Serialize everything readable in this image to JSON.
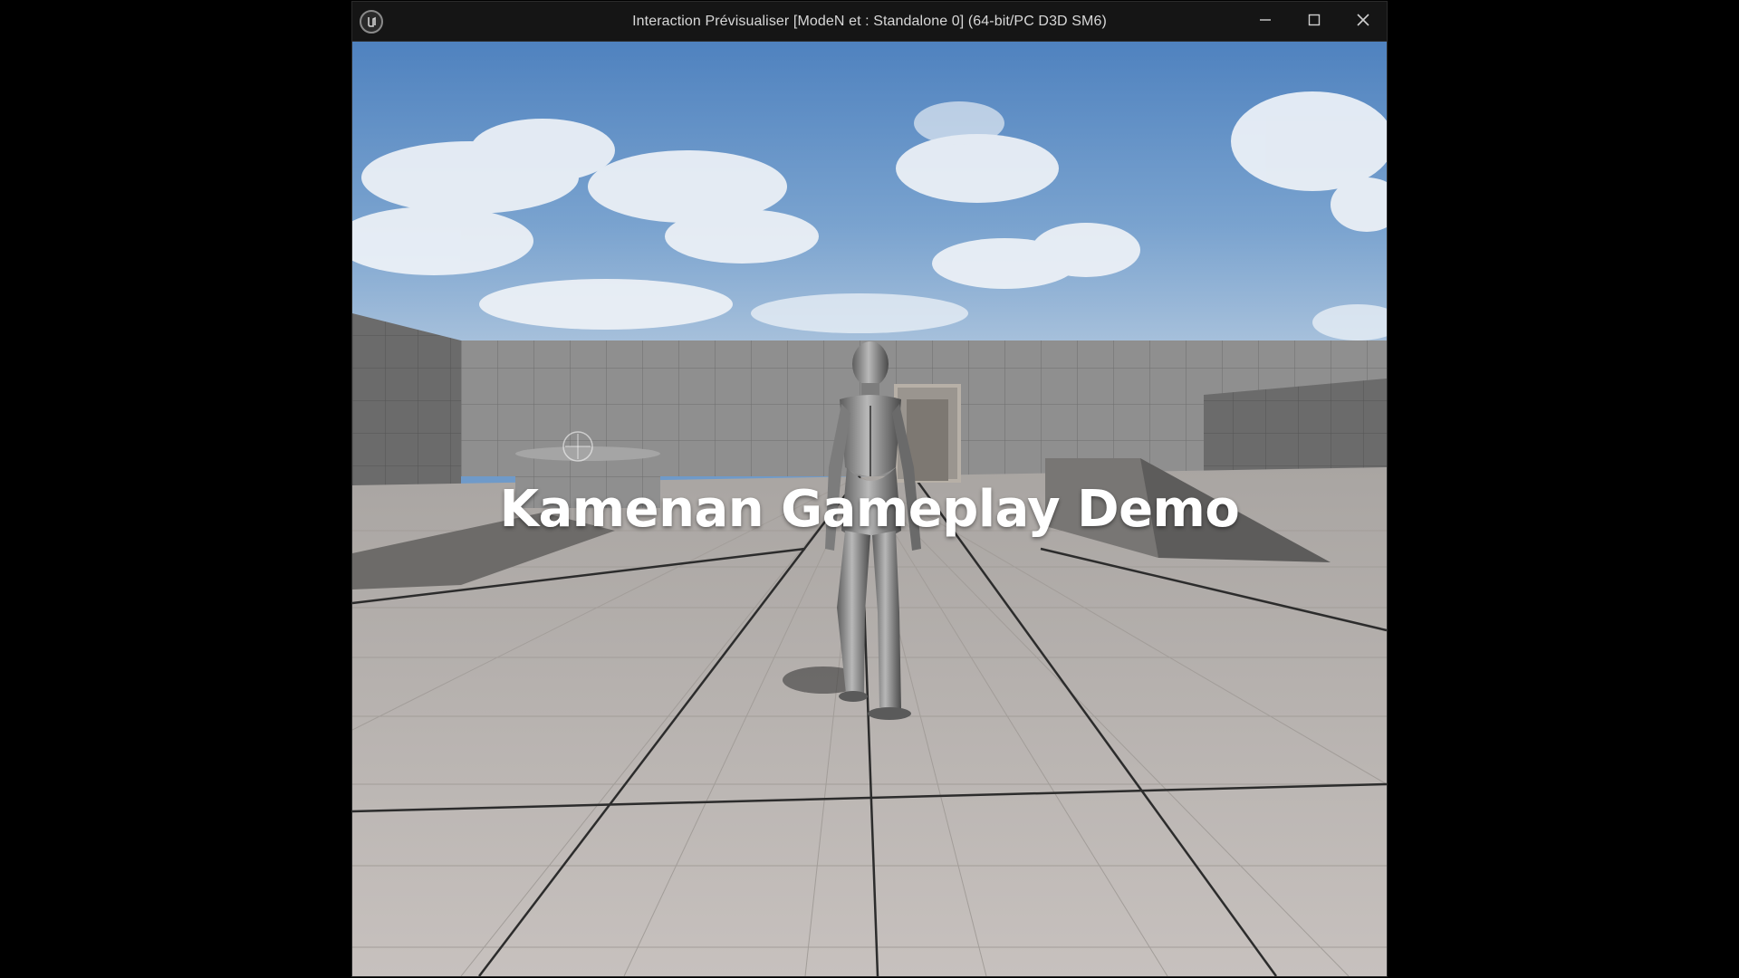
{
  "window": {
    "title": "Interaction Prévisualiser [ModeN et : Standalone 0]  (64-bit/PC D3D SM6)",
    "logo_icon": "unreal-engine-logo",
    "buttons": [
      {
        "name": "minimize",
        "icon": "minimize-icon"
      },
      {
        "name": "maximize",
        "icon": "maximize-icon"
      },
      {
        "name": "close",
        "icon": "close-icon"
      }
    ]
  },
  "game": {
    "overlay_title": "Kamenan Gameplay Demo",
    "crosshair_icon": "crosshair-icon",
    "colors": {
      "sky": "#6f9ac9",
      "floor": "#bdb8b5",
      "wall": "#8e8e8e",
      "title_text": "#ffffff"
    }
  }
}
